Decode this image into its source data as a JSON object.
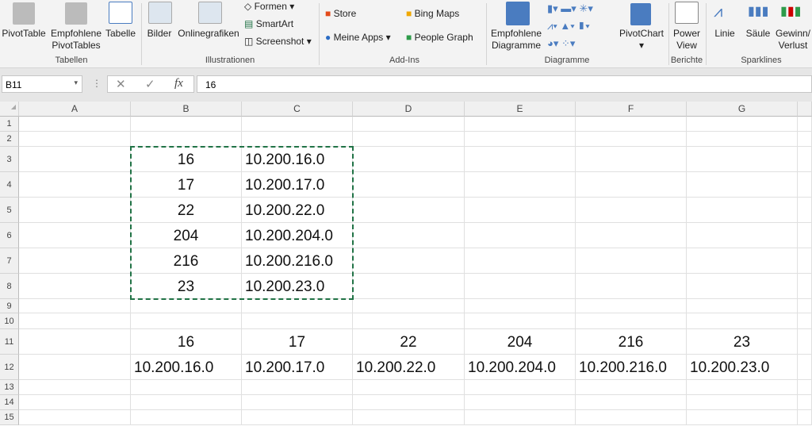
{
  "ribbon": {
    "tabellen": {
      "group": "Tabellen",
      "pivottable": "PivotTable",
      "empfohlene1": "Empfohlene",
      "empfohlene2": "PivotTables",
      "tabelle": "Tabelle"
    },
    "illustrationen": {
      "group": "Illustrationen",
      "bilder": "Bilder",
      "online": "Onlinegrafiken",
      "formen": "Formen",
      "smartart": "SmartArt",
      "screenshot": "Screenshot"
    },
    "addins": {
      "group": "Add-Ins",
      "store": "Store",
      "meineapps": "Meine Apps",
      "bing": "Bing Maps",
      "people": "People Graph"
    },
    "diagramme": {
      "group": "Diagramme",
      "empf1": "Empfohlene",
      "empf2": "Diagramme",
      "pivotchart": "PivotChart"
    },
    "berichte": {
      "group": "Berichte",
      "power1": "Power",
      "power2": "View"
    },
    "sparklines": {
      "group": "Sparklines",
      "linie": "Linie",
      "saeule": "Säule",
      "gewinn1": "Gewinn/",
      "gewinn2": "Verlust"
    }
  },
  "formula": {
    "namebox": "B11",
    "fx": "fx",
    "value": "16"
  },
  "columns": [
    "A",
    "B",
    "C",
    "D",
    "E",
    "F",
    "G"
  ],
  "rows": [
    "1",
    "2",
    "3",
    "4",
    "5",
    "6",
    "7",
    "8",
    "9",
    "10",
    "11",
    "12",
    "13",
    "14",
    "15"
  ],
  "cells": {
    "colB": [
      "16",
      "17",
      "22",
      "204",
      "216",
      "23"
    ],
    "colC": [
      "10.200.16.0",
      "10.200.17.0",
      "10.200.22.0",
      "10.200.204.0",
      "10.200.216.0",
      "10.200.23.0"
    ],
    "row11": [
      "16",
      "17",
      "22",
      "204",
      "216",
      "23"
    ],
    "row12": [
      "10.200.16.0",
      "10.200.17.0",
      "10.200.22.0",
      "10.200.204.0",
      "10.200.216.0",
      "10.200.23.0"
    ]
  },
  "colors": {
    "marquee": "#217346",
    "accent": "#217346"
  }
}
